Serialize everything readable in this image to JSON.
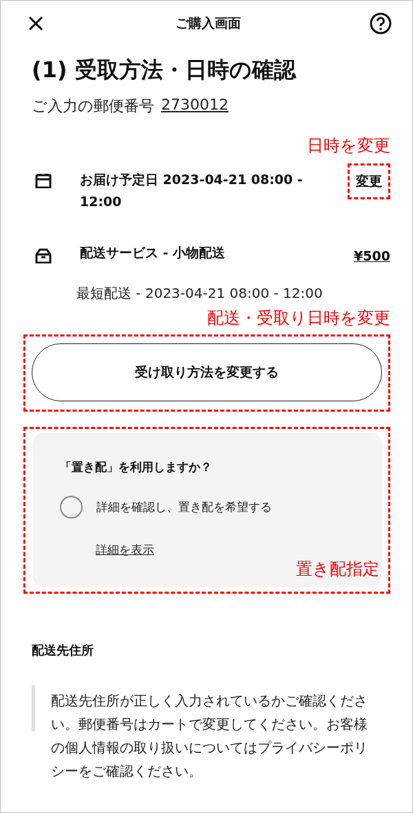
{
  "header": {
    "title": "ご購入画面"
  },
  "heading": "(1) 受取方法・日時の確認",
  "postal": {
    "label": "ご入力の郵便番号",
    "value": "2730012"
  },
  "delivery_date": {
    "annotation": "日時を変更",
    "label": "お届け予定日 2023-04-21 08:00 - 12:00",
    "change_link": "変更"
  },
  "shipping": {
    "label": "配送サービス - 小物配送",
    "price": "¥500",
    "detail": "最短配送 - 2023-04-21 08:00 - 12:00",
    "annotation": "配送・受取り日時を変更",
    "button": "受け取り方法を変更する"
  },
  "okihai": {
    "question": "「置き配」を利用しますか？",
    "option": {
      "label": "詳細を確認し、置き配を希望する",
      "selected": false
    },
    "details_link": "詳細を表示",
    "annotation": "置き配指定"
  },
  "address": {
    "title": "配送先住所",
    "note": "配送先住所が正しく入力されているかご確認ください。郵便番号はカートで変更してください。お客様の個人情報の取り扱いについてはプライバシーポリシーをご確認ください。"
  }
}
